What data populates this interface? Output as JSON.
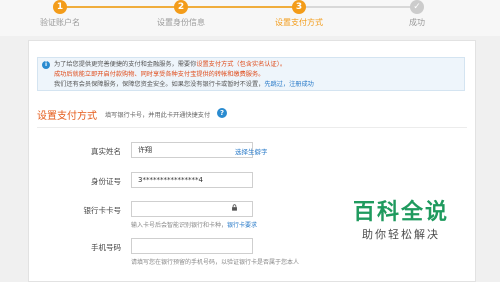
{
  "steps": [
    {
      "number": "1",
      "label": "验证账户名"
    },
    {
      "number": "2",
      "label": "设置身份信息"
    },
    {
      "number": "3",
      "label": "设置支付方式"
    },
    {
      "number": "✓",
      "label": "成功"
    }
  ],
  "notice": {
    "line1_prefix": "为了给您提供更完善便捷的支付和金融服务，需要你",
    "line1_red": "设置支付方式（包含实名认证）。",
    "line2_red": "成功后就能立即开启付款购物、同时享受各种支付宝提供的转帐和缴费服务。",
    "line3_prefix": "我们还有会员保障服务，保障您资金安全。如果您没有银行卡或暂时不设置，",
    "line3_link": "先跳过，注册成功"
  },
  "section": {
    "title": "设置支付方式",
    "hint": "填写银行卡号，并用此卡开通快捷支付",
    "help_icon": "?"
  },
  "form": {
    "name_label": "真实姓名",
    "name_value": "许翔",
    "name_link": "选择生僻字",
    "id_label": "身份证号",
    "id_value": "3****************4",
    "card_label": "银行卡卡号",
    "card_value": "",
    "card_tip_prefix": "输入卡号后会智能识别银行和卡种，",
    "card_tip_link": "银行卡要求",
    "phone_label": "手机号码",
    "phone_value": "",
    "phone_tip": "请填写您在银行预留的手机号码，以验证银行卡是否属于您本人"
  },
  "watermark": {
    "title": "百科全说",
    "subtitle": "助你轻松解决"
  },
  "colors": {
    "accent_orange": "#f39c1a",
    "title_orange": "#e55b1a",
    "link_blue": "#2a7bc9",
    "watermark_green": "#1f9a5e"
  }
}
